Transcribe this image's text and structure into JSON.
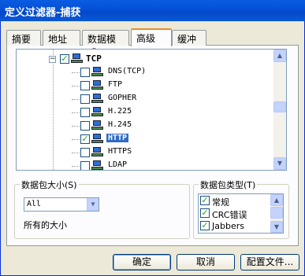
{
  "window": {
    "title": "定义过滤器-捕获"
  },
  "tabs": [
    {
      "label": "摘要"
    },
    {
      "label": "地址"
    },
    {
      "label": "数据模式"
    },
    {
      "label": "高级"
    },
    {
      "label": "缓冲"
    }
  ],
  "tree": {
    "root": {
      "label": "TCP",
      "checked": true,
      "expanded": true
    },
    "items": [
      {
        "label": "DNS(TCP)",
        "checked": false,
        "selected": false
      },
      {
        "label": "FTP",
        "checked": false,
        "selected": false
      },
      {
        "label": "GOPHER",
        "checked": false,
        "selected": false
      },
      {
        "label": "H.225",
        "checked": false,
        "selected": false
      },
      {
        "label": "H.245",
        "checked": false,
        "selected": false
      },
      {
        "label": "HTTP",
        "checked": true,
        "selected": true
      },
      {
        "label": "HTTPS",
        "checked": false,
        "selected": false
      },
      {
        "label": "LDAP",
        "checked": false,
        "selected": false
      }
    ]
  },
  "packet_size": {
    "group_label": "数据包大小(S)",
    "selected": "All",
    "description": "所有的大小"
  },
  "packet_type": {
    "group_label": "数据包类型(T)",
    "items": [
      {
        "label": "常规",
        "checked": true
      },
      {
        "label": "CRC错误",
        "checked": true
      },
      {
        "label": "Jabbers",
        "checked": true
      }
    ]
  },
  "buttons": {
    "ok": "确定",
    "cancel": "取消",
    "profiles": "配置文件..."
  },
  "colors": {
    "title_bar": "#0550d8",
    "selection": "#316ac5",
    "tab_accent": "#e68b2c"
  }
}
